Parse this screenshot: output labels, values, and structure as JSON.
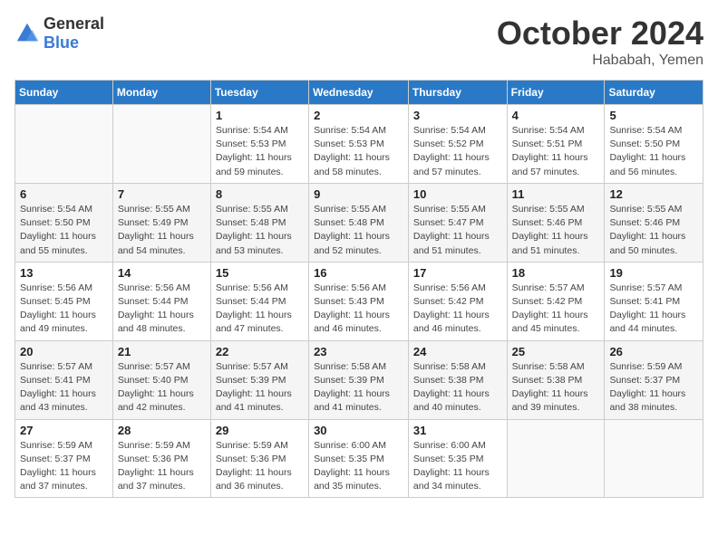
{
  "header": {
    "logo_general": "General",
    "logo_blue": "Blue",
    "month_year": "October 2024",
    "location": "Hababah, Yemen"
  },
  "days_of_week": [
    "Sunday",
    "Monday",
    "Tuesday",
    "Wednesday",
    "Thursday",
    "Friday",
    "Saturday"
  ],
  "weeks": [
    [
      {
        "day": "",
        "info": ""
      },
      {
        "day": "",
        "info": ""
      },
      {
        "day": "1",
        "sunrise": "5:54 AM",
        "sunset": "5:53 PM",
        "daylight": "11 hours and 59 minutes."
      },
      {
        "day": "2",
        "sunrise": "5:54 AM",
        "sunset": "5:53 PM",
        "daylight": "11 hours and 58 minutes."
      },
      {
        "day": "3",
        "sunrise": "5:54 AM",
        "sunset": "5:52 PM",
        "daylight": "11 hours and 57 minutes."
      },
      {
        "day": "4",
        "sunrise": "5:54 AM",
        "sunset": "5:51 PM",
        "daylight": "11 hours and 57 minutes."
      },
      {
        "day": "5",
        "sunrise": "5:54 AM",
        "sunset": "5:50 PM",
        "daylight": "11 hours and 56 minutes."
      }
    ],
    [
      {
        "day": "6",
        "sunrise": "5:54 AM",
        "sunset": "5:50 PM",
        "daylight": "11 hours and 55 minutes."
      },
      {
        "day": "7",
        "sunrise": "5:55 AM",
        "sunset": "5:49 PM",
        "daylight": "11 hours and 54 minutes."
      },
      {
        "day": "8",
        "sunrise": "5:55 AM",
        "sunset": "5:48 PM",
        "daylight": "11 hours and 53 minutes."
      },
      {
        "day": "9",
        "sunrise": "5:55 AM",
        "sunset": "5:48 PM",
        "daylight": "11 hours and 52 minutes."
      },
      {
        "day": "10",
        "sunrise": "5:55 AM",
        "sunset": "5:47 PM",
        "daylight": "11 hours and 51 minutes."
      },
      {
        "day": "11",
        "sunrise": "5:55 AM",
        "sunset": "5:46 PM",
        "daylight": "11 hours and 51 minutes."
      },
      {
        "day": "12",
        "sunrise": "5:55 AM",
        "sunset": "5:46 PM",
        "daylight": "11 hours and 50 minutes."
      }
    ],
    [
      {
        "day": "13",
        "sunrise": "5:56 AM",
        "sunset": "5:45 PM",
        "daylight": "11 hours and 49 minutes."
      },
      {
        "day": "14",
        "sunrise": "5:56 AM",
        "sunset": "5:44 PM",
        "daylight": "11 hours and 48 minutes."
      },
      {
        "day": "15",
        "sunrise": "5:56 AM",
        "sunset": "5:44 PM",
        "daylight": "11 hours and 47 minutes."
      },
      {
        "day": "16",
        "sunrise": "5:56 AM",
        "sunset": "5:43 PM",
        "daylight": "11 hours and 46 minutes."
      },
      {
        "day": "17",
        "sunrise": "5:56 AM",
        "sunset": "5:42 PM",
        "daylight": "11 hours and 46 minutes."
      },
      {
        "day": "18",
        "sunrise": "5:57 AM",
        "sunset": "5:42 PM",
        "daylight": "11 hours and 45 minutes."
      },
      {
        "day": "19",
        "sunrise": "5:57 AM",
        "sunset": "5:41 PM",
        "daylight": "11 hours and 44 minutes."
      }
    ],
    [
      {
        "day": "20",
        "sunrise": "5:57 AM",
        "sunset": "5:41 PM",
        "daylight": "11 hours and 43 minutes."
      },
      {
        "day": "21",
        "sunrise": "5:57 AM",
        "sunset": "5:40 PM",
        "daylight": "11 hours and 42 minutes."
      },
      {
        "day": "22",
        "sunrise": "5:57 AM",
        "sunset": "5:39 PM",
        "daylight": "11 hours and 41 minutes."
      },
      {
        "day": "23",
        "sunrise": "5:58 AM",
        "sunset": "5:39 PM",
        "daylight": "11 hours and 41 minutes."
      },
      {
        "day": "24",
        "sunrise": "5:58 AM",
        "sunset": "5:38 PM",
        "daylight": "11 hours and 40 minutes."
      },
      {
        "day": "25",
        "sunrise": "5:58 AM",
        "sunset": "5:38 PM",
        "daylight": "11 hours and 39 minutes."
      },
      {
        "day": "26",
        "sunrise": "5:59 AM",
        "sunset": "5:37 PM",
        "daylight": "11 hours and 38 minutes."
      }
    ],
    [
      {
        "day": "27",
        "sunrise": "5:59 AM",
        "sunset": "5:37 PM",
        "daylight": "11 hours and 37 minutes."
      },
      {
        "day": "28",
        "sunrise": "5:59 AM",
        "sunset": "5:36 PM",
        "daylight": "11 hours and 37 minutes."
      },
      {
        "day": "29",
        "sunrise": "5:59 AM",
        "sunset": "5:36 PM",
        "daylight": "11 hours and 36 minutes."
      },
      {
        "day": "30",
        "sunrise": "6:00 AM",
        "sunset": "5:35 PM",
        "daylight": "11 hours and 35 minutes."
      },
      {
        "day": "31",
        "sunrise": "6:00 AM",
        "sunset": "5:35 PM",
        "daylight": "11 hours and 34 minutes."
      },
      {
        "day": "",
        "info": ""
      },
      {
        "day": "",
        "info": ""
      }
    ]
  ],
  "labels": {
    "sunrise_prefix": "Sunrise: ",
    "sunset_prefix": "Sunset: ",
    "daylight_prefix": "Daylight: "
  }
}
